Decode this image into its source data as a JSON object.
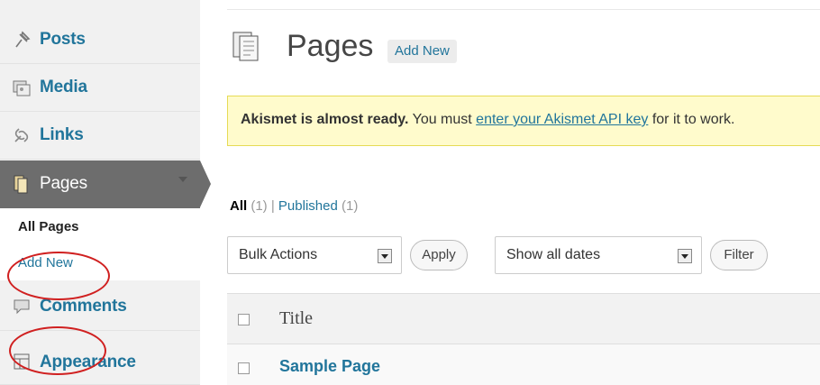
{
  "sidebar": {
    "items": [
      {
        "label": "Posts",
        "icon": "pushpin-icon"
      },
      {
        "label": "Media",
        "icon": "media-icon"
      },
      {
        "label": "Links",
        "icon": "link-icon"
      },
      {
        "label": "Pages",
        "icon": "pages-icon"
      },
      {
        "label": "Comments",
        "icon": "comments-icon"
      },
      {
        "label": "Appearance",
        "icon": "appearance-icon"
      }
    ],
    "submenu": [
      {
        "label": "All Pages"
      },
      {
        "label": "Add New"
      }
    ]
  },
  "header": {
    "title": "Pages",
    "add_new": "Add New"
  },
  "notice": {
    "bold": "Akismet is almost ready.",
    "pre": " You must ",
    "link": "enter your Akismet API key",
    "post": " for it to work."
  },
  "views": {
    "all": "All",
    "all_count": "(1)",
    "sep": " | ",
    "published": "Published",
    "published_count": "(1)"
  },
  "filters": {
    "bulk_actions": "Bulk Actions",
    "apply": "Apply",
    "dates": "Show all dates",
    "filter": "Filter"
  },
  "table": {
    "column_title": "Title",
    "rows": [
      {
        "title": "Sample Page"
      }
    ]
  },
  "colors": {
    "link": "#21759b",
    "active_menu": "#6d6d6d",
    "notice_bg": "#fffbcc",
    "annotation": "#d02020"
  }
}
